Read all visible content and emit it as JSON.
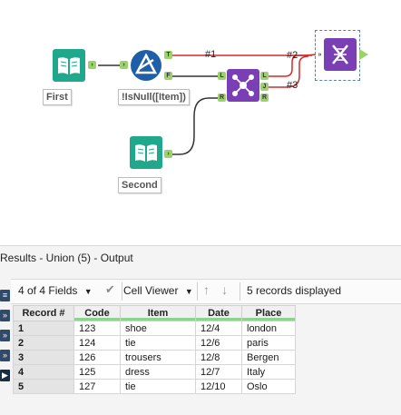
{
  "canvas": {
    "tools": {
      "input_first": {
        "label": "First",
        "icon": "book-input-icon"
      },
      "filter": {
        "label": "!IsNull([Item])",
        "icon": "filter-icon",
        "true_anchor": "T",
        "false_anchor": "F"
      },
      "union": {
        "icon": "union-icon",
        "anchors_in": [
          "L",
          "R"
        ],
        "anchors_out": [
          "L",
          "J",
          "R"
        ]
      },
      "input_second": {
        "label": "Second",
        "icon": "book-input-icon"
      },
      "output": {
        "icon": "dna-icon"
      }
    },
    "connections": {
      "c1": "#1",
      "c2": "#2",
      "c3": "#3"
    },
    "colors": {
      "input_tool": "#1fa88c",
      "filter_tool": "#1f5fa8",
      "union_tool": "#7a3fb5",
      "output_tool": "#7a3fb5",
      "anchor": "#9ad36a",
      "connection_named": "#d32a2a",
      "connection": "#333333"
    }
  },
  "results": {
    "title": "Results - Union (5) - Output",
    "toolbar": {
      "fields": "4 of 4 Fields",
      "viewer": "Cell Viewer",
      "records": "5 records displayed"
    },
    "columns": [
      "Record #",
      "Code",
      "Item",
      "Date",
      "Place"
    ],
    "rows": [
      [
        "1",
        "123",
        "shoe",
        "12/4",
        "london"
      ],
      [
        "2",
        "124",
        "tie",
        "12/6",
        "paris"
      ],
      [
        "3",
        "126",
        "trousers",
        "12/8",
        "Bergen"
      ],
      [
        "4",
        "125",
        "dress",
        "12/7",
        "Italy"
      ],
      [
        "5",
        "127",
        "tie",
        "12/10",
        "Oslo"
      ]
    ]
  }
}
